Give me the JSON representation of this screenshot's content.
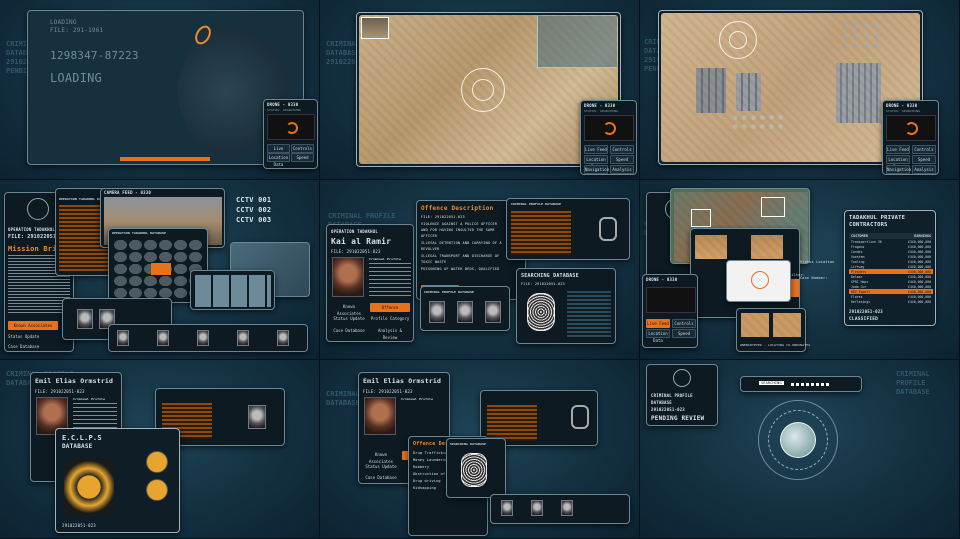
{
  "colors": {
    "accent": "#f08a2a",
    "panel": "#0d1a22",
    "background": "#133040"
  },
  "cell1": {
    "lines": [
      "LOADING",
      "FILE: 291-1961",
      "1298347-87223",
      "LOADING"
    ],
    "ghost": [
      "CRIMINAL",
      "DATABASE",
      "291022",
      "PENDING"
    ]
  },
  "drone": {
    "title": "DRONE - 0330",
    "status": "STATUS: SEARCHING",
    "buttons": [
      "Live Feed",
      "Controls",
      "Location Data",
      "Speed",
      "Navigation",
      "Analysis"
    ]
  },
  "ghost_profile": {
    "l1": "CRIMINAL PROFILE",
    "l2": "DATABASE",
    "l3": "291022051-023",
    "l4": "PENDING REVIEW"
  },
  "mission": {
    "op": "OPERATION TADAKHUL",
    "file": "FILE: 291022051-023",
    "title": "Mission Brief",
    "btn1": "Known Associates",
    "btn2": "Status Update",
    "btn3": "Case Database"
  },
  "camera": {
    "title": "CAMERA FEED - 0330",
    "op": "OPERATION TADAKHUL DATABASE",
    "cctv": [
      "CCTV 001",
      "CCTV 002",
      "CCTV 003"
    ]
  },
  "kai": {
    "op": "OPERATION TADAKHUL",
    "name": "Kai al Ramir",
    "file": "FILE: 291022051-023",
    "profile": "Criminal Profile",
    "b1": "Known Associates",
    "b2": "Offence Description",
    "b3": "Status Update",
    "b4": "Profile Category",
    "b5": "Case Database",
    "b6": "Analysis & Review"
  },
  "offence": {
    "title": "Offence Description",
    "lines": [
      "FILE: 291022051-023",
      "VIOLENCE AGAINST A POLICE OFFICER",
      "AND FOR HAVING INSULTED THE SAME",
      "OFFICER",
      "ILLEGAL DETENTION AND CARRYING OF A",
      "REVOLVER",
      "ILLEGAL TRANSPORT AND DISCHARGE OF",
      "TOXIC WASTE",
      "POISONING OF WATER BEDS, QUALIFIED"
    ],
    "b1": "Case Database",
    "b2": "Analysis & Review"
  },
  "search": {
    "crim": "CRIMINAL PROFILE DATABASE",
    "title": "SEARCHING DATABASE",
    "file": "FILE: 291022051-023"
  },
  "contractors": {
    "title": "TADAKHUL PRIVATE CONTRACTORS",
    "h1": "CUSTOMER",
    "h2": "EARNINGS",
    "rows": [
      [
        "Transportline 36",
        "£340,000,000"
      ],
      [
        "Fragons",
        "£440,000,000"
      ],
      [
        "Condes",
        "£440,000,000"
      ],
      [
        "Voestem",
        "£440,000,000"
      ],
      [
        "Tooling",
        "£440,000,000"
      ],
      [
        "Liftway",
        "£440,000,000"
      ],
      [
        "Plenders",
        "£440,000,000"
      ],
      [
        "Delmar",
        "£440,000,000"
      ],
      [
        "SPRI Hopx",
        "£440,000,000"
      ],
      [
        "Joda Cur",
        "£440,000,000"
      ],
      [
        "HDV Expert",
        "£440,000,000"
      ],
      [
        "Flares",
        "£440,000,000"
      ],
      [
        "Reflexings",
        "£440,000,000"
      ]
    ],
    "file": "291022051-023",
    "classified": "CLASSIFIED"
  },
  "intel": {
    "uncrypt": "UNENCRYPTED - LOCATING CO-ORDINATES",
    "filter": "Filter:",
    "loc": "Status Location",
    "case": "Case Number:"
  },
  "emil": {
    "name": "Emil Elias Ormstrid",
    "file": "FILE: 291022051-023",
    "profile": "Criminal Profile",
    "b1": "Known Associates",
    "b2": "Offence Description",
    "b3": "Status Update",
    "b4": "Profile Category",
    "b5": "Case Database",
    "b6": "Analysis & Review"
  },
  "eclips": {
    "title": "E.C.L.P.S",
    "sub": "DATABASE",
    "file": "291022051-023"
  },
  "offence2": {
    "title": "Offence Description",
    "lines": [
      "Drug Trafficking",
      "Money Laundering",
      "Robbery",
      "Obstruction of justice",
      "Drug driving",
      "Kidnapping"
    ]
  },
  "cell9": {
    "l1": "CRIMINAL PROFILE",
    "l2": "DATABASE",
    "l3": "291022051-023",
    "l4": "PENDING REVIEW",
    "search_label": "SEARCHING"
  }
}
